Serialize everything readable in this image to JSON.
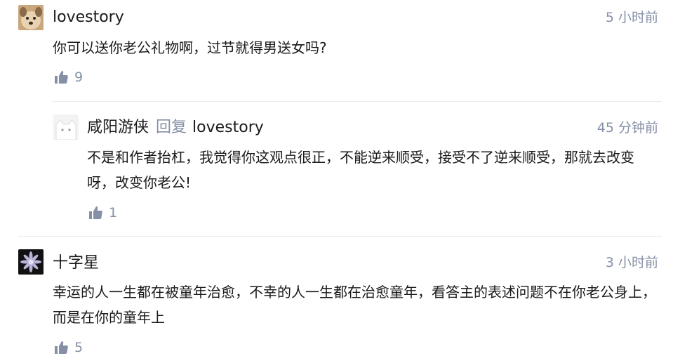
{
  "comments": [
    {
      "author": "lovestory",
      "time": "5 小时前",
      "content": "你可以送你老公礼物啊，过节就得男送女吗?",
      "likes": "9",
      "avatar_icon": "dog-avatar"
    },
    {
      "author": "咸阳游侠",
      "reply_word": "回复",
      "reply_to": "lovestory",
      "time": "45 分钟前",
      "content": "不是和作者抬杠，我觉得你这观点很正，不能逆来顺受，接受不了逆来顺受，那就去改变呀，改变你老公!",
      "likes": "1",
      "avatar_icon": "cat-avatar"
    },
    {
      "author": "十字星",
      "time": "3 小时前",
      "content": "幸运的人一生都在被童年治愈，不幸的人一生都在治愈童年，看答主的表述问题不在你老公身上，而是在你的童年上",
      "likes": "5",
      "avatar_icon": "flower-avatar"
    }
  ],
  "colors": {
    "text": "#1a1a1a",
    "meta": "#8590a6",
    "divider": "#ebebeb"
  }
}
